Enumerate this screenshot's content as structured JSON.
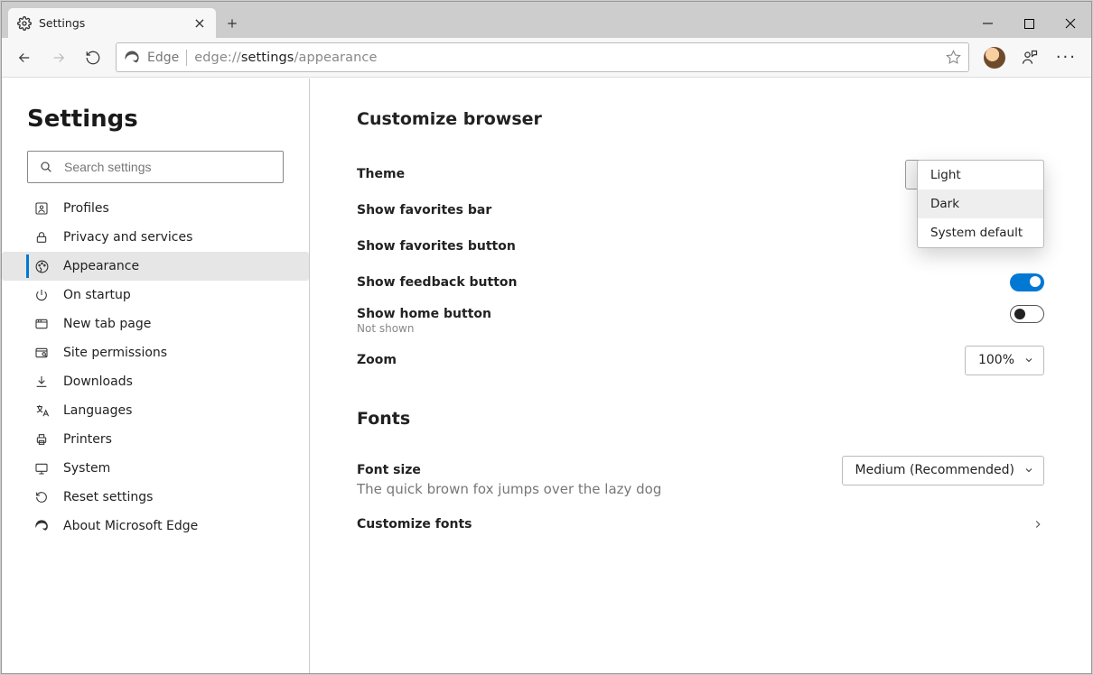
{
  "tab": {
    "title": "Settings"
  },
  "toolbar": {
    "edge_label": "Edge",
    "url_prefix": "edge://",
    "url_bold": "settings",
    "url_suffix": "/appearance"
  },
  "sidebar": {
    "title": "Settings",
    "search_placeholder": "Search settings",
    "items": [
      {
        "label": "Profiles"
      },
      {
        "label": "Privacy and services"
      },
      {
        "label": "Appearance"
      },
      {
        "label": "On startup"
      },
      {
        "label": "New tab page"
      },
      {
        "label": "Site permissions"
      },
      {
        "label": "Downloads"
      },
      {
        "label": "Languages"
      },
      {
        "label": "Printers"
      },
      {
        "label": "System"
      },
      {
        "label": "Reset settings"
      },
      {
        "label": "About Microsoft Edge"
      }
    ]
  },
  "main": {
    "section_customize": "Customize browser",
    "theme_label": "Theme",
    "theme_value": "System default",
    "theme_options": [
      "Light",
      "Dark",
      "System default"
    ],
    "show_fav_bar": "Show favorites bar",
    "show_fav_btn": "Show favorites button",
    "show_feedback": "Show feedback button",
    "show_home": "Show home button",
    "show_home_sub": "Not shown",
    "zoom_label": "Zoom",
    "zoom_value": "100%",
    "section_fonts": "Fonts",
    "font_size_label": "Font size",
    "font_size_value": "Medium (Recommended)",
    "font_preview": "The quick brown fox jumps over the lazy dog",
    "customize_fonts": "Customize fonts"
  }
}
